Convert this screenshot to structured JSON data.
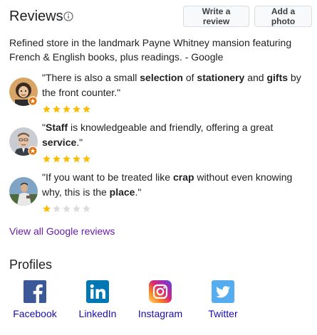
{
  "header": {
    "title": "Reviews",
    "write_review_label": "Write a review",
    "add_photo_label": "Add a photo"
  },
  "summary": "Refined store in the landmark Payne Whitney mansion featuring French & English books, plus readings. - Google",
  "reviews": [
    {
      "parts": [
        {
          "t": "\"There is also a small ",
          "b": false
        },
        {
          "t": "selection",
          "b": true
        },
        {
          "t": " of ",
          "b": false
        },
        {
          "t": "stationery",
          "b": true
        },
        {
          "t": " and ",
          "b": false
        },
        {
          "t": "gifts",
          "b": true
        },
        {
          "t": " by the front counter.\"",
          "b": false
        }
      ],
      "rating": 5,
      "local_guide": true
    },
    {
      "parts": [
        {
          "t": "\"",
          "b": false
        },
        {
          "t": "Staff",
          "b": true
        },
        {
          "t": " is knowledgeable and friendly, offering a great ",
          "b": false
        },
        {
          "t": "service",
          "b": true
        },
        {
          "t": ".\"",
          "b": false
        }
      ],
      "rating": 5,
      "local_guide": true
    },
    {
      "parts": [
        {
          "t": "\"If you want to be treated like ",
          "b": false
        },
        {
          "t": "crap",
          "b": true
        },
        {
          "t": " without even knowing why, this is the ",
          "b": false
        },
        {
          "t": "place",
          "b": true
        },
        {
          "t": ".\"",
          "b": false
        }
      ],
      "rating": 1,
      "local_guide": false
    }
  ],
  "view_all_label": "View all Google reviews",
  "profiles": {
    "title": "Profiles",
    "items": [
      {
        "label": "Facebook",
        "icon": "facebook-icon",
        "color": "#3b5998"
      },
      {
        "label": "LinkedIn",
        "icon": "linkedin-icon",
        "color": "#0077b5"
      },
      {
        "label": "Instagram",
        "icon": "instagram-icon",
        "color": "#c13584"
      },
      {
        "label": "Twitter",
        "icon": "twitter-icon",
        "color": "#55acee"
      }
    ]
  },
  "colors": {
    "star_filled": "#fbbc04",
    "star_empty": "#dadce0",
    "link_visited": "#681da8",
    "link": "#1a0dab",
    "guide_badge": "#e8710a"
  }
}
